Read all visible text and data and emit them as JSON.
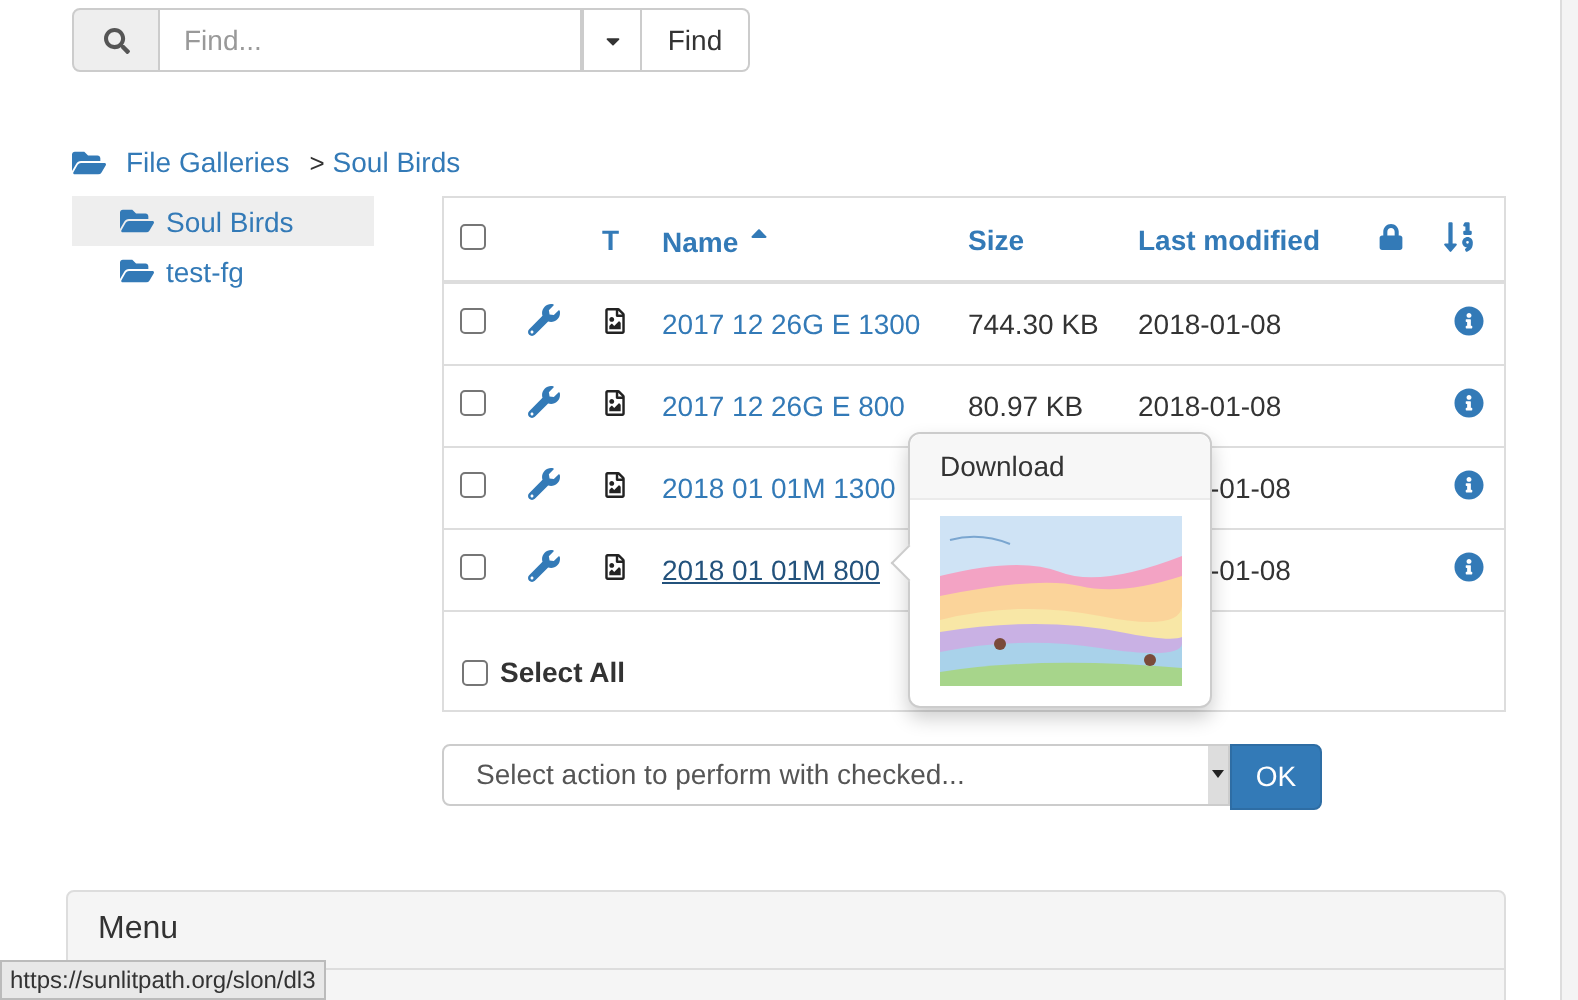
{
  "search": {
    "placeholder": "Find...",
    "button": "Find"
  },
  "breadcrumb": [
    {
      "label": "File Galleries"
    },
    {
      "label": "Soul Birds"
    }
  ],
  "breadcrumb_separator": ">",
  "tree": [
    {
      "label": "Soul Birds",
      "selected": true
    },
    {
      "label": "test-fg",
      "selected": false
    }
  ],
  "table": {
    "header_checkbox": {
      "checked": false
    },
    "columns": {
      "type": "T",
      "name": "Name",
      "size": "Size",
      "modified": "Last modified"
    },
    "rows": [
      {
        "name": "2017 12 26G E 1300",
        "size": "744.30 KB",
        "modified": "2018-01-08",
        "checked": false,
        "hovered": false
      },
      {
        "name": "2017 12 26G E 800",
        "size": "80.97 KB",
        "modified": "2018-01-08",
        "checked": false,
        "hovered": false
      },
      {
        "name": "2018 01 01M 1300",
        "modified": "-01-08",
        "checked": false,
        "hovered": false
      },
      {
        "name": "2018 01 01M 800",
        "modified": "-01-08",
        "checked": false,
        "hovered": true
      }
    ],
    "select_all": {
      "label": "Select All",
      "checked": false
    }
  },
  "popover": {
    "title": "Download",
    "kind": "picture"
  },
  "action": {
    "placeholder": "Select action to perform with checked...",
    "button": "OK"
  },
  "menu_panel": {
    "title": "Menu"
  },
  "status_url": "https://sunlitpath.org/slon/dl3"
}
